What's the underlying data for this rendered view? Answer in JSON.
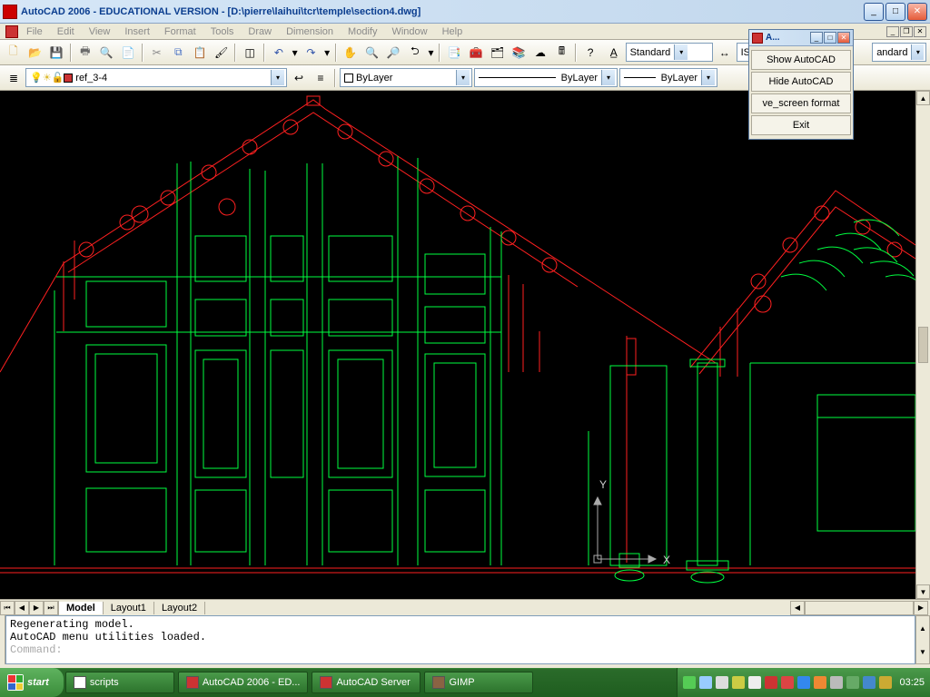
{
  "app": {
    "title": "AutoCAD 2006 - EDUCATIONAL VERSION - [D:\\pierre\\laihui\\tcr\\temple\\section4.dwg]"
  },
  "menu": [
    "File",
    "Edit",
    "View",
    "Insert",
    "Format",
    "Tools",
    "Draw",
    "Dimension",
    "Modify",
    "Window",
    "Help"
  ],
  "toolbar1": {
    "textstyle": "Standard",
    "dimstyle_prefix": "ISO",
    "right_style": "andard"
  },
  "toolbar2": {
    "layer": "ref_3-4",
    "color": "ByLayer",
    "linetype": "ByLayer",
    "lineweight": "ByLayer"
  },
  "tabs": {
    "active": "Model",
    "items": [
      "Model",
      "Layout1",
      "Layout2"
    ]
  },
  "command": {
    "lines": [
      "Regenerating model.",
      "AutoCAD menu utilities loaded."
    ],
    "prompt": "Command:"
  },
  "popup": {
    "title": "A...",
    "items": [
      "Show AutoCAD",
      "Hide AutoCAD",
      "ve_screen format",
      "Exit"
    ]
  },
  "taskbar": {
    "start": "start",
    "items": [
      {
        "label": "scripts"
      },
      {
        "label": "AutoCAD 2006 - ED..."
      },
      {
        "label": "AutoCAD Server"
      },
      {
        "label": "GIMP"
      }
    ],
    "clock": "03:25"
  },
  "ucs": {
    "x_label": "X",
    "y_label": "Y"
  }
}
